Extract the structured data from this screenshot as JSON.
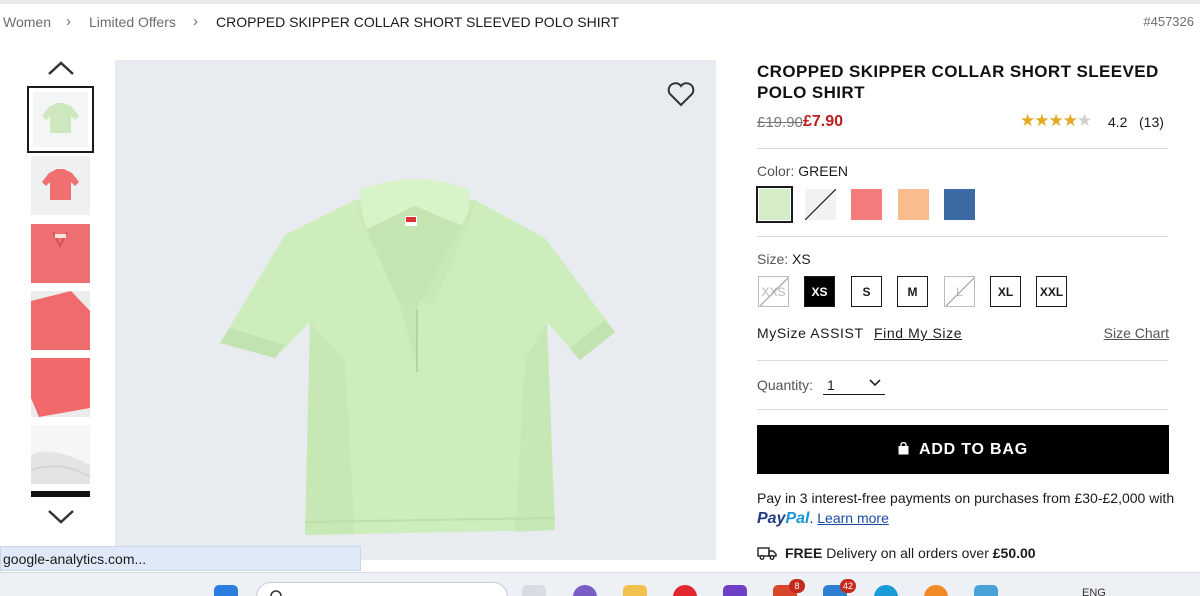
{
  "breadcrumb": {
    "items": [
      "Women",
      "Limited Offers"
    ],
    "current": "CROPPED SKIPPER COLLAR SHORT SLEEVED POLO SHIRT",
    "product_number": "#457326"
  },
  "product": {
    "title": "CROPPED SKIPPER COLLAR SHORT SLEEVED POLO SHIRT",
    "original_price": "£19.90",
    "sale_price": "£7.90",
    "rating": "4.2",
    "rating_value": 4.2,
    "review_count": "(13)",
    "color_label": "Color:",
    "selected_color": "GREEN",
    "size_label": "Size:",
    "selected_size": "XS"
  },
  "colors": [
    {
      "name": "green",
      "hex": "#d4ecc8",
      "selected": true
    },
    {
      "name": "white",
      "hex": "#f2f2f2",
      "unavailable": true
    },
    {
      "name": "pink",
      "hex": "#f47c7c"
    },
    {
      "name": "orange",
      "hex": "#f9bc8c"
    },
    {
      "name": "blue",
      "hex": "#3c6aa4"
    }
  ],
  "sizes": [
    {
      "label": "XXS",
      "unavailable": true
    },
    {
      "label": "XS",
      "selected": true
    },
    {
      "label": "S"
    },
    {
      "label": "M"
    },
    {
      "label": "L",
      "unavailable": true
    },
    {
      "label": "XL"
    },
    {
      "label": "XXL"
    }
  ],
  "mysize": {
    "label": "MySize ASSIST",
    "link": "Find My Size",
    "chart": "Size Chart"
  },
  "quantity": {
    "label": "Quantity:",
    "value": "1"
  },
  "add_to_bag": "ADD TO BAG",
  "paypal": {
    "text": "Pay in 3 interest-free payments on purchases from £30-£2,000 with",
    "brand_pay": "Pay",
    "brand_pal": "Pal",
    "link": "Learn more"
  },
  "delivery": {
    "bold": "FREE",
    "text": " Delivery on all orders over ",
    "amount": "£50.00"
  },
  "status_url": "google-analytics.com...",
  "taskbar": {
    "badge1": "8",
    "badge2": "42",
    "lang": "ENG"
  },
  "icons": {
    "up": "chevron-up-icon",
    "down": "chevron-down-icon",
    "heart": "heart-icon",
    "bag": "bag-icon",
    "truck": "truck-icon",
    "star": "star-icon"
  },
  "theme": {
    "price_red": "#b91e1e",
    "star_gold": "#e4a920",
    "paypal_blue": "#233b84",
    "paypal_light": "#1796d8"
  }
}
